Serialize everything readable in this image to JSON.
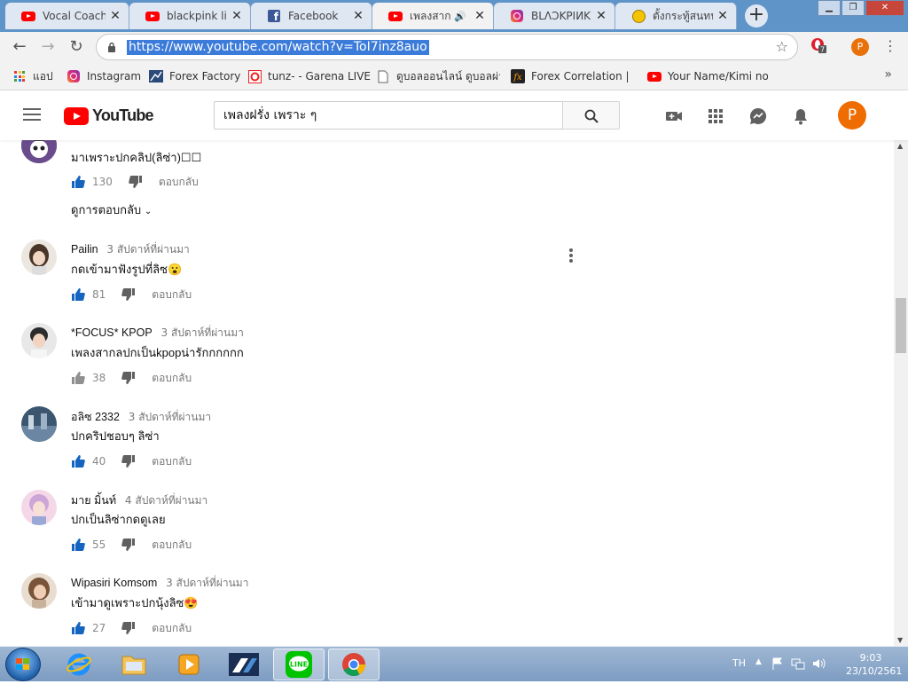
{
  "browser": {
    "tabs": [
      {
        "label": "Vocal Coach R",
        "icon": "youtube-icon"
      },
      {
        "label": "blackpink lisa",
        "icon": "youtube-icon"
      },
      {
        "label": "Facebook",
        "icon": "facebook-icon"
      },
      {
        "label": "เพลงสากล",
        "icon": "youtube-icon",
        "active": true,
        "audio": true
      },
      {
        "label": "BLΛƆKPIИK (@",
        "icon": "instagram-icon"
      },
      {
        "label": "ตั้งกระทู้สนทนา",
        "icon": "pantip-icon"
      }
    ],
    "url": "https://www.youtube.com/watch?v=ToI7inz8auo",
    "extension_badge": "7",
    "profile_initial": "P",
    "bookmarks": [
      {
        "label": "แอป",
        "icon": "apps-grid-icon"
      },
      {
        "label": "Instagram",
        "icon": "instagram-icon"
      },
      {
        "label": "Forex Factory",
        "icon": "forex-factory-icon"
      },
      {
        "label": "tunz- - Garena LIVE",
        "icon": "garena-icon"
      },
      {
        "label": "ดูบอลออนไลน์ ดูบอลผ่าน",
        "icon": "page-icon"
      },
      {
        "label": "Forex Correlation | M",
        "icon": "fx-icon"
      },
      {
        "label": "Your Name/Kimi no N",
        "icon": "youtube-icon"
      }
    ],
    "bookmarks_more": "»"
  },
  "youtube": {
    "logo_text": "YouTube",
    "search_query": "เพลงฝรั่ง เพราะ ๆ",
    "avatar_initial": "P",
    "brand_red": "#ff0000",
    "accent_blue": "#065fd4"
  },
  "comments": [
    {
      "author": "",
      "time": "",
      "text": "มาเพราะปกคลิป(ลิซ่า)☐☐",
      "likes": "130",
      "reply": "ตอบกลับ",
      "view_replies": "ดูการตอบกลับ",
      "partial": true
    },
    {
      "author": "Pailin",
      "time": "3 สัปดาห์ที่ผ่านมา",
      "text": "กดเข้ามาฟังรูปที่ลิซ😮",
      "likes": "81",
      "reply": "ตอบกลับ"
    },
    {
      "author": "*FOCUS* KPOP",
      "time": "3 สัปดาห์ที่ผ่านมา",
      "text": "เพลงสากลปกเป็นkpopน่ารักกกกกก",
      "likes": "38",
      "reply": "ตอบกลับ"
    },
    {
      "author": "อลิซ 2332",
      "time": "3 สัปดาห์ที่ผ่านมา",
      "text": "ปกคริปชอบๆ ลิซ่า",
      "likes": "40",
      "reply": "ตอบกลับ"
    },
    {
      "author": "มาย มิ้นท์",
      "time": "4 สัปดาห์ที่ผ่านมา",
      "text": "ปกเป็นลิซ่ากดดูเลย",
      "likes": "55",
      "reply": "ตอบกลับ"
    },
    {
      "author": "Wipasiri Komsom",
      "time": "3 สัปดาห์ที่ผ่านมา",
      "text": "เข้ามาดูเพราะปกนุ้งลิซ😍",
      "likes": "27",
      "reply": "ตอบกลับ"
    }
  ],
  "taskbar": {
    "items": [
      "internet-explorer-icon",
      "file-explorer-icon",
      "media-player-icon",
      "chart-app-icon",
      "line-icon",
      "chrome-icon"
    ],
    "language": "TH",
    "time": "9:03",
    "date": "23/10/2561"
  }
}
